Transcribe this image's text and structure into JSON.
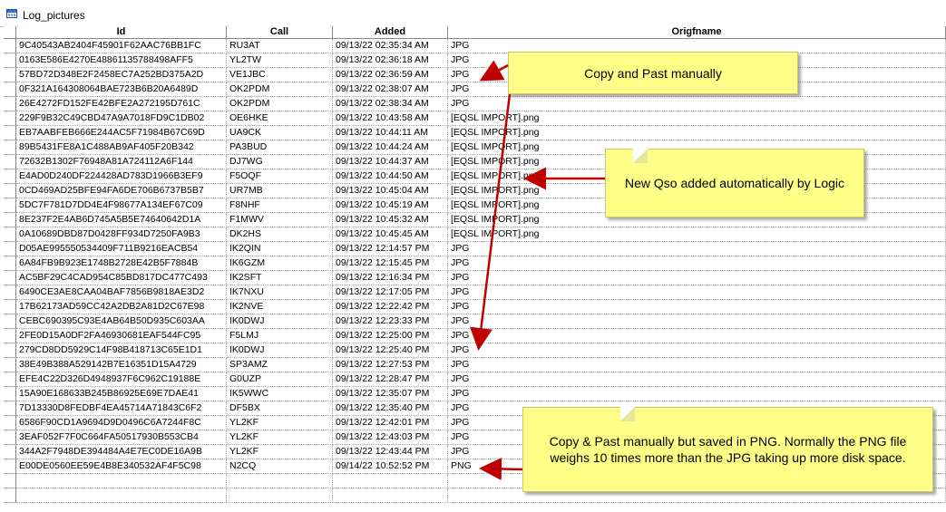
{
  "window": {
    "title": "Log_pictures",
    "icon": "table-icon"
  },
  "columns": [
    {
      "key": "id",
      "label": "Id"
    },
    {
      "key": "call",
      "label": "Call"
    },
    {
      "key": "added",
      "label": "Added"
    },
    {
      "key": "origfname",
      "label": "Origfname"
    }
  ],
  "rows": [
    {
      "id": "9C40543AB2404F45901F62AAC76BB1FC",
      "call": "RU3AT",
      "added": "09/13/22 02:35:34 AM",
      "origfname": "JPG"
    },
    {
      "id": "0163E586E4270E48861135788498AFF5",
      "call": "YL2TW",
      "added": "09/13/22 02:36:18 AM",
      "origfname": "JPG"
    },
    {
      "id": "57BD72D348E2F2458EC7A252BD375A2D",
      "call": "VE1JBC",
      "added": "09/13/22 02:36:59 AM",
      "origfname": "JPG"
    },
    {
      "id": "0F321A164308064BAE723B6B20A6489D",
      "call": "OK2PDM",
      "added": "09/13/22 02:38:07 AM",
      "origfname": "JPG"
    },
    {
      "id": "26E4272FD152FE42BFE2A272195D761C",
      "call": "OK2PDM",
      "added": "09/13/22 02:38:34 AM",
      "origfname": "JPG"
    },
    {
      "id": "229F9B32C49CBD47A9A7018FD9C1DB02",
      "call": "OE6HKE",
      "added": "09/13/22 10:43:58 AM",
      "origfname": "[EQSL IMPORT].png"
    },
    {
      "id": "EB7AABFEB666E244AC5F71984B67C69D",
      "call": "UA9CK",
      "added": "09/13/22 10:44:11 AM",
      "origfname": "[EQSL IMPORT].png"
    },
    {
      "id": "89B5431FE8A1C488AB9AF405F20B342",
      "call": "PA3BUD",
      "added": "09/13/22 10:44:24 AM",
      "origfname": "[EQSL IMPORT].png"
    },
    {
      "id": "72632B1302F76948A81A724112A6F144",
      "call": "DJ7WG",
      "added": "09/13/22 10:44:37 AM",
      "origfname": "[EQSL IMPORT].png"
    },
    {
      "id": "E4AD0D240DF224428AD783D1966B3EF9",
      "call": "F5OQF",
      "added": "09/13/22 10:44:50 AM",
      "origfname": "[EQSL IMPORT].png"
    },
    {
      "id": "0CD469AD25BFE94FA6DE706B6737B5B7",
      "call": "UR7MB",
      "added": "09/13/22 10:45:04 AM",
      "origfname": "[EQSL IMPORT].png"
    },
    {
      "id": "5DC7F781D7DD4E4F98677A134EF67C09",
      "call": "F8NHF",
      "added": "09/13/22 10:45:19 AM",
      "origfname": "[EQSL IMPORT].png"
    },
    {
      "id": "8E237F2E4AB6D745A5B5E74640642D1A",
      "call": "F1MWV",
      "added": "09/13/22 10:45:32 AM",
      "origfname": "[EQSL IMPORT].png"
    },
    {
      "id": "0A10689DBD87D0428FF934D7250FA9B3",
      "call": "DK2HS",
      "added": "09/13/22 10:45:45 AM",
      "origfname": "[EQSL IMPORT].png"
    },
    {
      "id": "D05AE995550534409F711B9216EACB54",
      "call": "IK2QIN",
      "added": "09/13/22 12:14:57 PM",
      "origfname": "JPG"
    },
    {
      "id": "6A84FB9B923E1748B2728E42B5F7884B",
      "call": "IK6GZM",
      "added": "09/13/22 12:15:45 PM",
      "origfname": "JPG"
    },
    {
      "id": "AC5BF29C4CAD954C85BD817DC477C493",
      "call": "IK2SFT",
      "added": "09/13/22 12:16:34 PM",
      "origfname": "JPG"
    },
    {
      "id": "6490CE3AE8CAA04BAF7856B9818AE3D2",
      "call": "IK7NXU",
      "added": "09/13/22 12:17:05 PM",
      "origfname": "JPG"
    },
    {
      "id": "17B62173AD59CC42A2DB2A81D2C67E98",
      "call": "IK2NVE",
      "added": "09/13/22 12:22:42 PM",
      "origfname": "JPG"
    },
    {
      "id": "CEBC690395C93E4AB64B50D935C603AA",
      "call": "IK0DWJ",
      "added": "09/13/22 12:23:33 PM",
      "origfname": "JPG"
    },
    {
      "id": "2FE0D15A0DF2FA46930681EAF544FC95",
      "call": "F5LMJ",
      "added": "09/13/22 12:25:00 PM",
      "origfname": "JPG"
    },
    {
      "id": "279CD8DD5929C14F98B418713C65E1D1",
      "call": "IK0DWJ",
      "added": "09/13/22 12:25:40 PM",
      "origfname": "JPG"
    },
    {
      "id": "38E49B388A529142B7E16351D15A4729",
      "call": "SP3AMZ",
      "added": "09/13/22 12:27:53 PM",
      "origfname": "JPG"
    },
    {
      "id": "EFE4C22D326D4948937F6C962C19188E",
      "call": "G0UZP",
      "added": "09/13/22 12:28:47 PM",
      "origfname": "JPG"
    },
    {
      "id": "15A90E168633B245B86925E69E7DAE41",
      "call": "IK5WWC",
      "added": "09/13/22 12:35:07 PM",
      "origfname": "JPG"
    },
    {
      "id": "7D13330D8FEDBF4EA45714A71843C6F2",
      "call": "DF5BX",
      "added": "09/13/22 12:35:40 PM",
      "origfname": "JPG"
    },
    {
      "id": "6586F90CD1A9694D9D0496C6A7244F8C",
      "call": "YL2KF",
      "added": "09/13/22 12:42:01 PM",
      "origfname": "JPG"
    },
    {
      "id": "3EAF052F7F0C664FA50517930B553CB4",
      "call": "YL2KF",
      "added": "09/13/22 12:43:03 PM",
      "origfname": "JPG"
    },
    {
      "id": "344A2F7948DE394484A4E7EC0DE16A9B",
      "call": "YL2KF",
      "added": "09/13/22 12:43:44 PM",
      "origfname": "JPG"
    },
    {
      "id": "E00DE0560EE59E4B8E340532AF4F5C98",
      "call": "N2CQ",
      "added": "09/14/22 10:52:52 PM",
      "origfname": "PNG"
    },
    {
      "id": "",
      "call": "",
      "added": "",
      "origfname": ""
    },
    {
      "id": "",
      "call": "",
      "added": "",
      "origfname": ""
    }
  ],
  "notes": {
    "copy_paste": "Copy and Past manually",
    "auto": "New Qso added automatically by Logic",
    "png": "Copy & Past manually but saved in PNG. Normally the PNG file weighs 10 times more than the JPG taking up more disk space."
  },
  "colors": {
    "note_bg": "#ffff88",
    "arrow": "#c00000"
  }
}
